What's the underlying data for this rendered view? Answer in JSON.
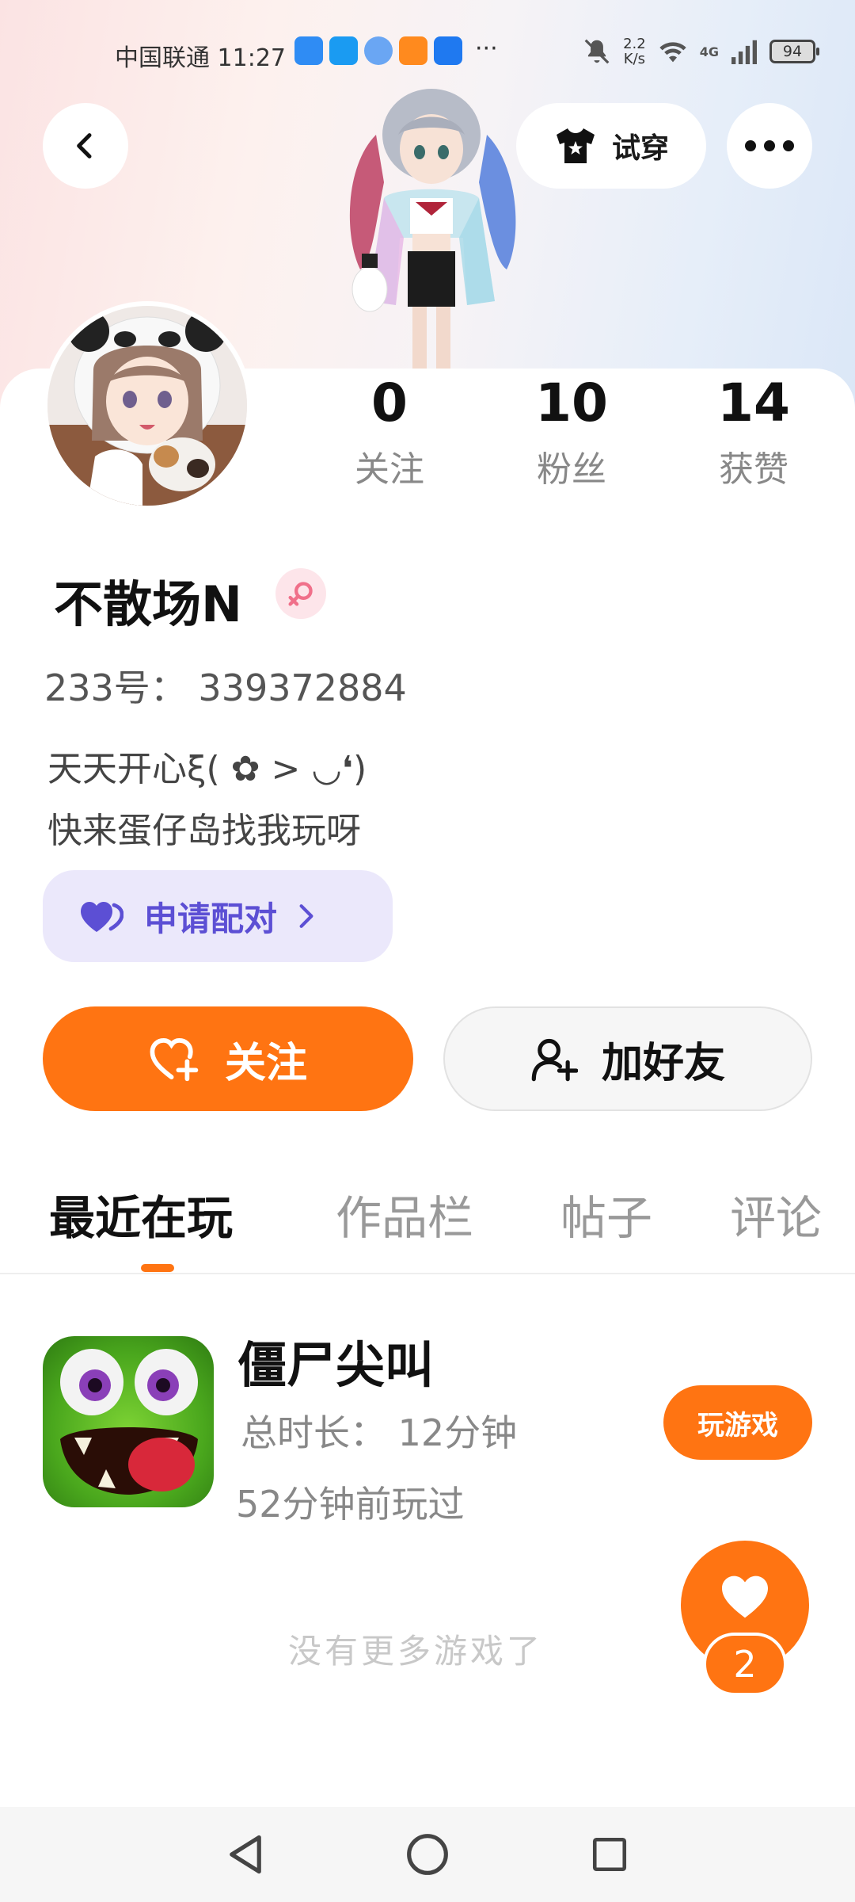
{
  "status_bar": {
    "carrier": "中国联通",
    "time": "11:27",
    "net_speed": "2.2",
    "net_speed_unit": "K/s",
    "network_type": "4G",
    "battery": "94",
    "overflow": "···"
  },
  "header": {
    "tryon_label": "试穿"
  },
  "stats": [
    {
      "value": "0",
      "label": "关注"
    },
    {
      "value": "10",
      "label": "粉丝"
    },
    {
      "value": "14",
      "label": "获赞"
    }
  ],
  "profile": {
    "username": "不散场N",
    "gender": "female",
    "id_line": "233号： 339372884",
    "bio_line1": "天天开心ξ( ✿ > ◡❛)",
    "bio_line2": "快来蛋仔岛找我玩呀",
    "pair_label": "申请配对"
  },
  "actions": {
    "follow_label": "关注",
    "add_friend_label": "加好友"
  },
  "tabs": [
    {
      "label": "最近在玩",
      "active": true
    },
    {
      "label": "作品栏",
      "active": false
    },
    {
      "label": "帖子",
      "active": false
    },
    {
      "label": "评论",
      "active": false
    }
  ],
  "recent_game": {
    "title": "僵尸尖叫",
    "duration": "总时长： 12分钟",
    "last_played": "52分钟前玩过",
    "play_label": "玩游戏"
  },
  "footer_text": "没有更多游戏了",
  "like_count": "2",
  "colors": {
    "accent": "#ff7412",
    "pair_bg": "#ebe8fb",
    "pair_text": "#5c4fd4",
    "gender_badge": "#fde5ea"
  }
}
